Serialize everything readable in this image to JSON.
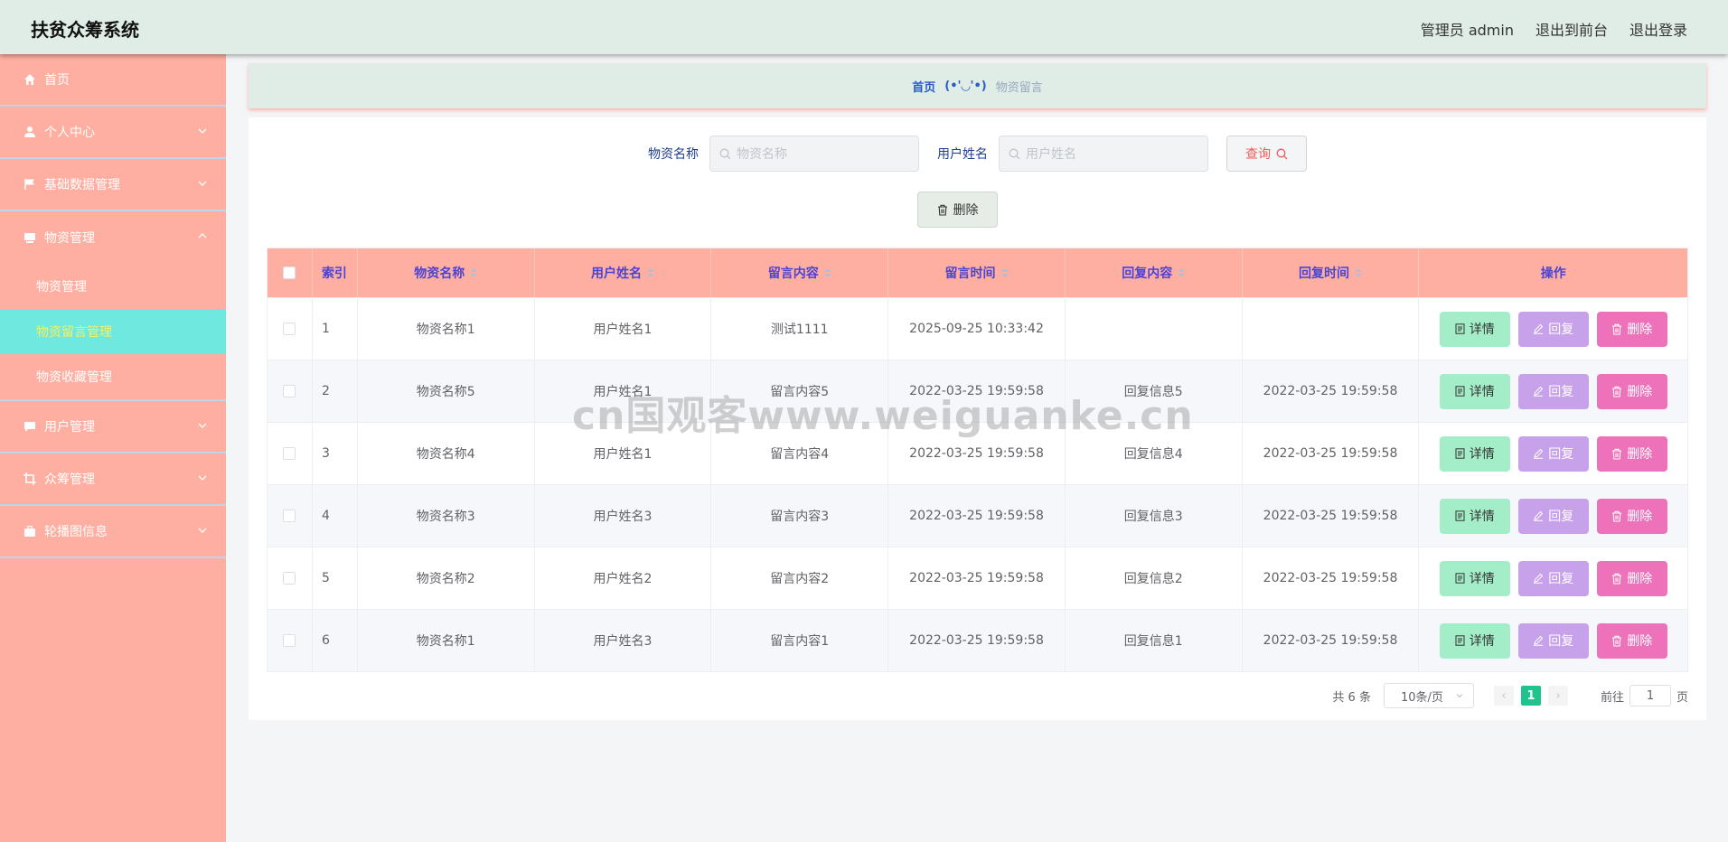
{
  "app": {
    "title": "扶贫众筹系统",
    "admin_label": "管理员 admin",
    "front_label": "退出到前台",
    "logout_label": "退出登录"
  },
  "sidebar": {
    "items": [
      {
        "label": "首页",
        "icon": "home-icon"
      },
      {
        "label": "个人中心",
        "icon": "user-icon"
      },
      {
        "label": "基础数据管理",
        "icon": "flag-icon"
      },
      {
        "label": "物资管理",
        "icon": "box-icon"
      },
      {
        "label": "用户管理",
        "icon": "chat-icon"
      },
      {
        "label": "众筹管理",
        "icon": "crop-icon"
      },
      {
        "label": "轮播图信息",
        "icon": "briefcase-icon"
      }
    ],
    "sub_items": [
      "物资管理",
      "物资留言管理",
      "物资收藏管理"
    ]
  },
  "breadcrumb": {
    "home": "首页",
    "separator": "(•'◡'•)",
    "current": "物资留言"
  },
  "search": {
    "label1": "物资名称",
    "placeholder1": "物资名称",
    "label2": "用户姓名",
    "placeholder2": "用户姓名",
    "query_label": "查询",
    "delete_label": "删除"
  },
  "table": {
    "headers": [
      "索引",
      "物资名称",
      "用户姓名",
      "留言内容",
      "留言时间",
      "回复内容",
      "回复时间",
      "操作"
    ],
    "rows": [
      {
        "idx": "1",
        "name": "物资名称1",
        "user": "用户姓名1",
        "msg": "测试1111",
        "msg_time": "2025-09-25 10:33:42",
        "reply": "",
        "reply_time": ""
      },
      {
        "idx": "2",
        "name": "物资名称5",
        "user": "用户姓名1",
        "msg": "留言内容5",
        "msg_time": "2022-03-25 19:59:58",
        "reply": "回复信息5",
        "reply_time": "2022-03-25 19:59:58"
      },
      {
        "idx": "3",
        "name": "物资名称4",
        "user": "用户姓名1",
        "msg": "留言内容4",
        "msg_time": "2022-03-25 19:59:58",
        "reply": "回复信息4",
        "reply_time": "2022-03-25 19:59:58"
      },
      {
        "idx": "4",
        "name": "物资名称3",
        "user": "用户姓名3",
        "msg": "留言内容3",
        "msg_time": "2022-03-25 19:59:58",
        "reply": "回复信息3",
        "reply_time": "2022-03-25 19:59:58"
      },
      {
        "idx": "5",
        "name": "物资名称2",
        "user": "用户姓名2",
        "msg": "留言内容2",
        "msg_time": "2022-03-25 19:59:58",
        "reply": "回复信息2",
        "reply_time": "2022-03-25 19:59:58"
      },
      {
        "idx": "6",
        "name": "物资名称1",
        "user": "用户姓名3",
        "msg": "留言内容1",
        "msg_time": "2022-03-25 19:59:58",
        "reply": "回复信息1",
        "reply_time": "2022-03-25 19:59:58"
      }
    ],
    "action_labels": {
      "detail": "详情",
      "reply": "回复",
      "delete": "删除"
    }
  },
  "pagination": {
    "total": "共 6 条",
    "page_size": "10条/页",
    "current_page": "1",
    "goto_prefix": "前往",
    "goto_value": "1",
    "goto_suffix": "页"
  },
  "watermark": "cn国观客www.weiguanke.cn",
  "colors": {
    "header_bg": "#e0ede6",
    "sidebar_bg": "#feafa1",
    "active_sub_bg": "#6fe8df",
    "table_header_bg": "#feafa1",
    "page_active": "#1ec38d",
    "detail_btn": "#a3eec8",
    "reply_btn": "#c7a2ea",
    "delete_btn": "#ee72b9"
  }
}
